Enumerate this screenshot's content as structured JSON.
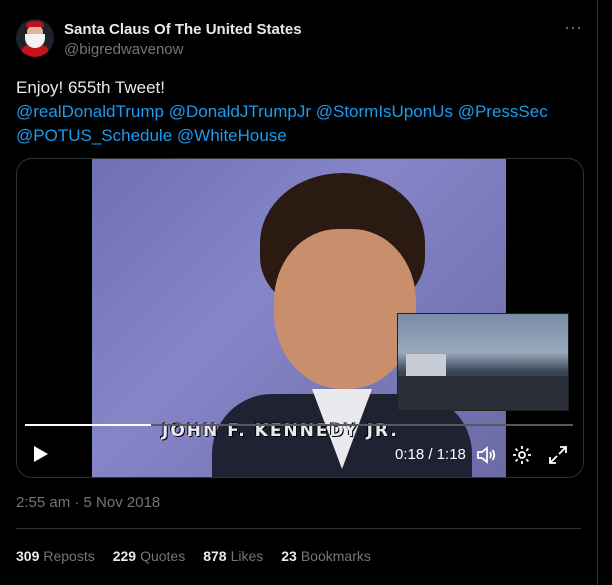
{
  "author": {
    "display_name": "Santa Claus Of The United States",
    "handle": "@bigredwavenow"
  },
  "more_icon": "more-horizontal-icon",
  "tweet": {
    "text": "Enjoy! 655th Tweet!",
    "mentions": [
      "@realDonaldTrump",
      "@DonaldJTrumpJr",
      "@StormIsUponUs",
      "@PressSec",
      "@POTUS_Schedule",
      "@WhiteHouse"
    ]
  },
  "video": {
    "caption": "JOHN F. KENNEDY JR.",
    "time": "0:18 / 1:18",
    "progress": 0.23,
    "controls": [
      "play-icon",
      "volume-icon",
      "settings-icon",
      "fullscreen-icon"
    ]
  },
  "timestamp": "2:55 am · 5 Nov 2018",
  "stats": [
    {
      "count": "309",
      "label": "Reposts"
    },
    {
      "count": "229",
      "label": "Quotes"
    },
    {
      "count": "878",
      "label": "Likes"
    },
    {
      "count": "23",
      "label": "Bookmarks"
    }
  ],
  "colors": {
    "accent": "#1d9bf0",
    "muted": "#71767b",
    "text": "#e7e9ea",
    "background": "#000000"
  }
}
